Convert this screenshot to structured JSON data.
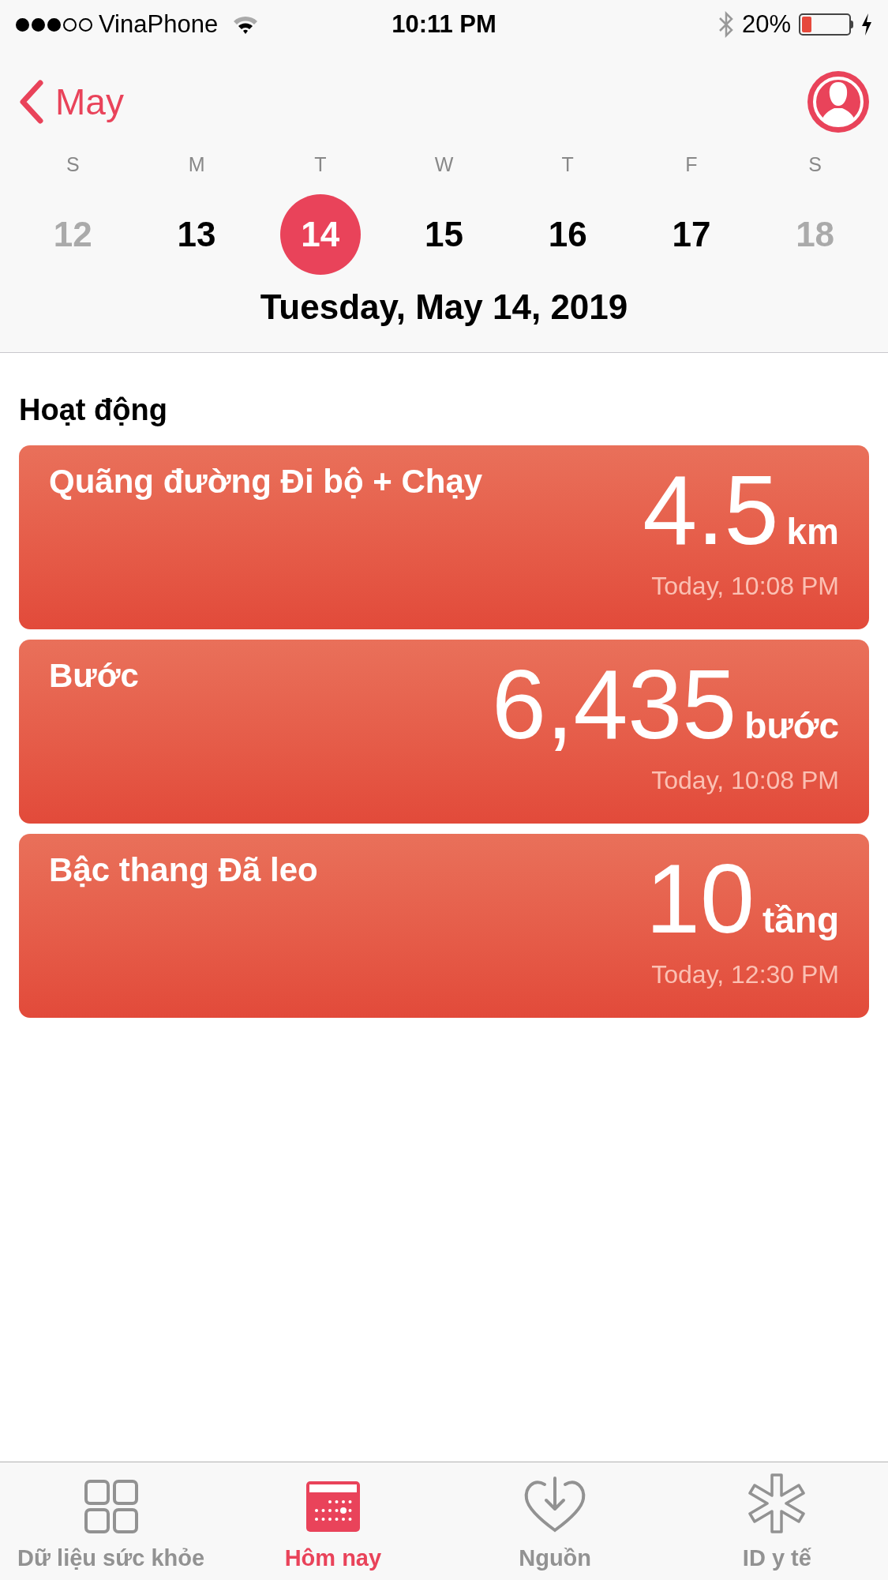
{
  "status_bar": {
    "carrier": "VinaPhone",
    "time": "10:11 PM",
    "battery": "20%"
  },
  "nav": {
    "back_label": "May"
  },
  "week": [
    {
      "letter": "S",
      "day": "12",
      "selected": false,
      "dimmed": true
    },
    {
      "letter": "M",
      "day": "13",
      "selected": false,
      "dimmed": false
    },
    {
      "letter": "T",
      "day": "14",
      "selected": true,
      "dimmed": false
    },
    {
      "letter": "W",
      "day": "15",
      "selected": false,
      "dimmed": false
    },
    {
      "letter": "T",
      "day": "16",
      "selected": false,
      "dimmed": false
    },
    {
      "letter": "F",
      "day": "17",
      "selected": false,
      "dimmed": false
    },
    {
      "letter": "S",
      "day": "18",
      "selected": false,
      "dimmed": true
    }
  ],
  "date_title": "Tuesday, May 14, 2019",
  "section_title": "Hoạt động",
  "cards": [
    {
      "title": "Quãng đường Đi bộ + Chạy",
      "value": "4.5",
      "unit": "km",
      "time": "Today, 10:08 PM"
    },
    {
      "title": "Bước",
      "value": "6,435",
      "unit": "bước",
      "time": "Today, 10:08 PM"
    },
    {
      "title": "Bậc thang Đã leo",
      "value": "10",
      "unit": "tầng",
      "time": "Today, 12:30 PM"
    }
  ],
  "tab_bar": [
    {
      "kind": "grid",
      "label": "Dữ liệu sức khỏe",
      "selected": false
    },
    {
      "kind": "calendar",
      "label": "Hôm nay",
      "selected": true
    },
    {
      "kind": "sources",
      "label": "Nguồn",
      "selected": false
    },
    {
      "kind": "medical",
      "label": "ID y tế",
      "selected": false
    }
  ]
}
